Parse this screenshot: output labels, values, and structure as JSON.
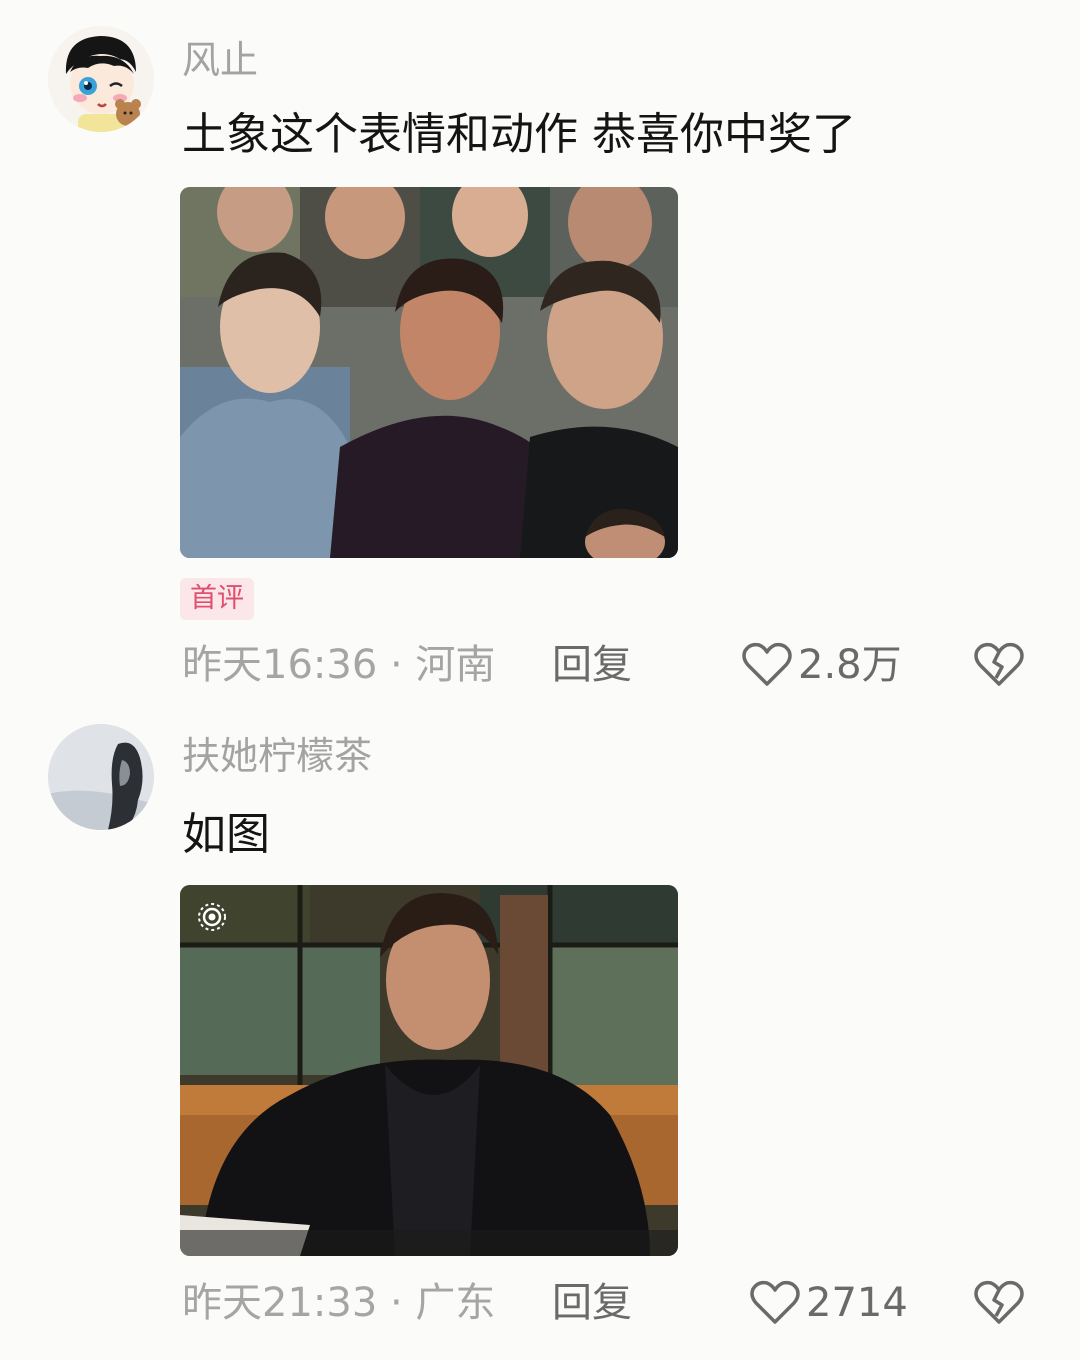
{
  "comments": [
    {
      "username": "风止",
      "text": "土象这个表情和动作 恭喜你中奖了",
      "badge": "首评",
      "meta": "昨天16:36 · 河南",
      "reply_label": "回复",
      "like_count": "2.8万",
      "avatar_icon": "cartoon-boy-avatar",
      "image_desc": "collage-photo"
    },
    {
      "username": "扶她柠檬茶",
      "text": "如图",
      "meta": "昨天21:33 · 广东",
      "reply_label": "回复",
      "like_count": "2714",
      "avatar_icon": "dark-figure-avatar",
      "image_desc": "animated-photo",
      "live_icon": "live-photo-icon"
    }
  ],
  "icons": {
    "like": "heart-outline-icon",
    "dislike": "broken-heart-icon"
  },
  "colors": {
    "badge_bg": "#fbe6ea",
    "badge_text": "#e0506e",
    "secondary_text": "#a5a5a5"
  }
}
